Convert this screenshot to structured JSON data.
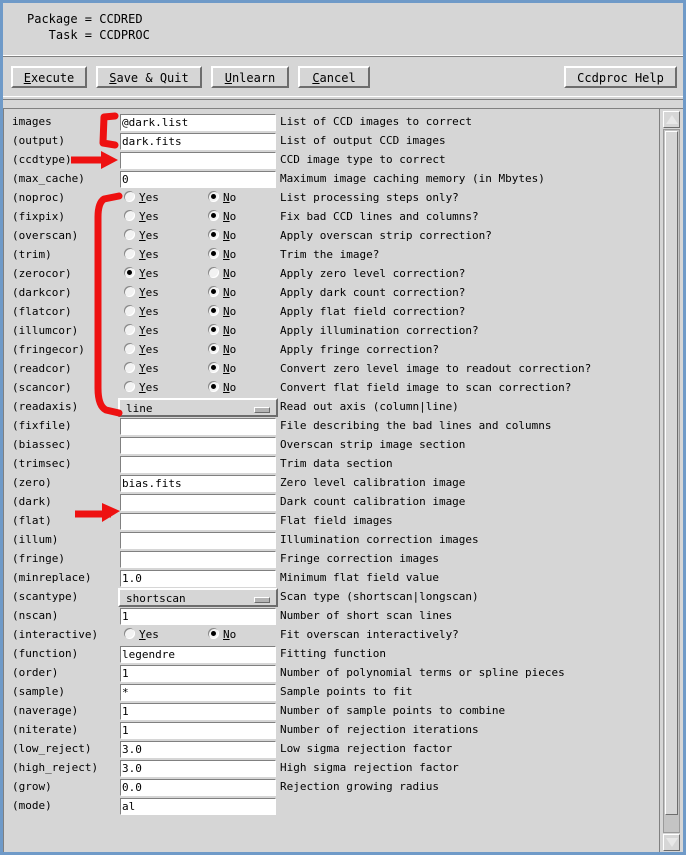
{
  "header": {
    "package_line": "Package = CCDRED",
    "task_line": "   Task = CCDPROC"
  },
  "toolbar": {
    "execute_label": "Execute",
    "save_quit_label": "Save & Quit",
    "unlearn_label": "Unlearn",
    "cancel_label": "Cancel",
    "help_label": "Ccdproc Help"
  },
  "radio": {
    "yes_label": "Yes",
    "no_label": "No"
  },
  "colors": {
    "window_background": "#d6d6d6",
    "window_border": "#6f9ac8",
    "entry_background": "#ffffff",
    "annotation_red": "#ee1111"
  },
  "scrollbar": {
    "up_arrow_icon": "triangle-up-icon",
    "down_arrow_icon": "triangle-down-icon"
  },
  "params": [
    {
      "name": "images",
      "type": "entry",
      "value": "@dark.list",
      "desc": "List of CCD images to correct"
    },
    {
      "name": "(output)",
      "type": "entry",
      "value": "dark.fits",
      "desc": "List of output CCD images"
    },
    {
      "name": "(ccdtype)",
      "type": "entry",
      "value": "",
      "desc": "CCD image type to correct"
    },
    {
      "name": "(max_cache)",
      "type": "entry",
      "value": "0",
      "desc": "Maximum image caching memory (in Mbytes)"
    },
    {
      "name": "(noproc)",
      "type": "radio",
      "value": "No",
      "desc": "List processing steps only?"
    },
    {
      "name": "(fixpix)",
      "type": "radio",
      "value": "No",
      "desc": "Fix bad CCD lines and columns?"
    },
    {
      "name": "(overscan)",
      "type": "radio",
      "value": "No",
      "desc": "Apply overscan strip correction?"
    },
    {
      "name": "(trim)",
      "type": "radio",
      "value": "No",
      "desc": "Trim the image?"
    },
    {
      "name": "(zerocor)",
      "type": "radio",
      "value": "Yes",
      "desc": "Apply zero level correction?"
    },
    {
      "name": "(darkcor)",
      "type": "radio",
      "value": "No",
      "desc": "Apply dark count correction?"
    },
    {
      "name": "(flatcor)",
      "type": "radio",
      "value": "No",
      "desc": "Apply flat field correction?"
    },
    {
      "name": "(illumcor)",
      "type": "radio",
      "value": "No",
      "desc": "Apply illumination correction?"
    },
    {
      "name": "(fringecor)",
      "type": "radio",
      "value": "No",
      "desc": "Apply fringe correction?"
    },
    {
      "name": "(readcor)",
      "type": "radio",
      "value": "No",
      "desc": "Convert zero level image to readout correction?"
    },
    {
      "name": "(scancor)",
      "type": "radio",
      "value": "No",
      "desc": "Convert flat field image to scan correction?"
    },
    {
      "name": "(readaxis)",
      "type": "option",
      "value": "line",
      "desc": "Read out axis (column|line)"
    },
    {
      "name": "(fixfile)",
      "type": "entry",
      "value": "",
      "desc": "File describing the bad lines and columns"
    },
    {
      "name": "(biassec)",
      "type": "entry",
      "value": "",
      "desc": "Overscan strip image section"
    },
    {
      "name": "(trimsec)",
      "type": "entry",
      "value": "",
      "desc": "Trim data section"
    },
    {
      "name": "(zero)",
      "type": "entry",
      "value": "bias.fits",
      "desc": "Zero level calibration image"
    },
    {
      "name": "(dark)",
      "type": "entry",
      "value": "",
      "desc": "Dark count calibration image"
    },
    {
      "name": "(flat)",
      "type": "entry",
      "value": "",
      "desc": "Flat field images"
    },
    {
      "name": "(illum)",
      "type": "entry",
      "value": "",
      "desc": "Illumination correction images"
    },
    {
      "name": "(fringe)",
      "type": "entry",
      "value": "",
      "desc": "Fringe correction images"
    },
    {
      "name": "(minreplace)",
      "type": "entry",
      "value": "1.0",
      "desc": "Minimum flat field value"
    },
    {
      "name": "(scantype)",
      "type": "option",
      "value": "shortscan",
      "desc": "Scan type (shortscan|longscan)"
    },
    {
      "name": "(nscan)",
      "type": "entry",
      "value": "1",
      "desc": "Number of short scan lines"
    },
    {
      "name": "(interactive)",
      "type": "radio",
      "value": "No",
      "desc": "Fit overscan interactively?"
    },
    {
      "name": "(function)",
      "type": "entry",
      "value": "legendre",
      "desc": "Fitting function"
    },
    {
      "name": "(order)",
      "type": "entry",
      "value": "1",
      "desc": "Number of polynomial terms or spline pieces"
    },
    {
      "name": "(sample)",
      "type": "entry",
      "value": "*",
      "desc": "Sample points to fit"
    },
    {
      "name": "(naverage)",
      "type": "entry",
      "value": "1",
      "desc": "Number of sample points to combine"
    },
    {
      "name": "(niterate)",
      "type": "entry",
      "value": "1",
      "desc": "Number of rejection iterations"
    },
    {
      "name": "(low_reject)",
      "type": "entry",
      "value": "3.0",
      "desc": "Low sigma rejection factor"
    },
    {
      "name": "(high_reject)",
      "type": "entry",
      "value": "3.0",
      "desc": "High sigma rejection factor"
    },
    {
      "name": "(grow)",
      "type": "entry",
      "value": "0.0",
      "desc": "Rejection growing radius"
    },
    {
      "name": "(mode)",
      "type": "entry",
      "value": "al",
      "desc": ""
    }
  ]
}
